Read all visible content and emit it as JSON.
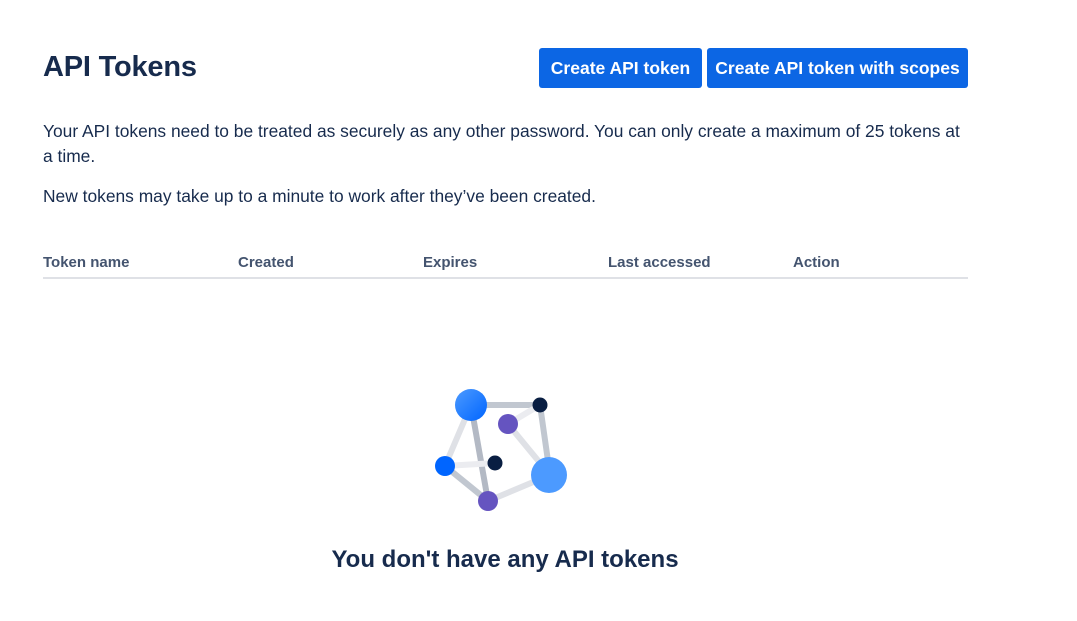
{
  "header": {
    "title": "API Tokens",
    "create_button": "Create API token",
    "create_scopes_button": "Create API token with scopes"
  },
  "description": {
    "paragraph1": "Your API tokens need to be treated as securely as any other password. You can only create a maximum of 25 tokens at a time.",
    "paragraph2": "New tokens may take up to a minute to work after they’ve been created."
  },
  "table": {
    "columns": [
      "Token name",
      "Created",
      "Expires",
      "Last accessed",
      "Action"
    ],
    "rows": []
  },
  "empty_state": {
    "illustration": "network-nodes-illustration",
    "message": "You don't have any API tokens"
  },
  "colors": {
    "primary_button": "#0c66e4",
    "heading_text": "#172b4d",
    "column_header_text": "#44546f",
    "divider": "#dfe1e6"
  }
}
